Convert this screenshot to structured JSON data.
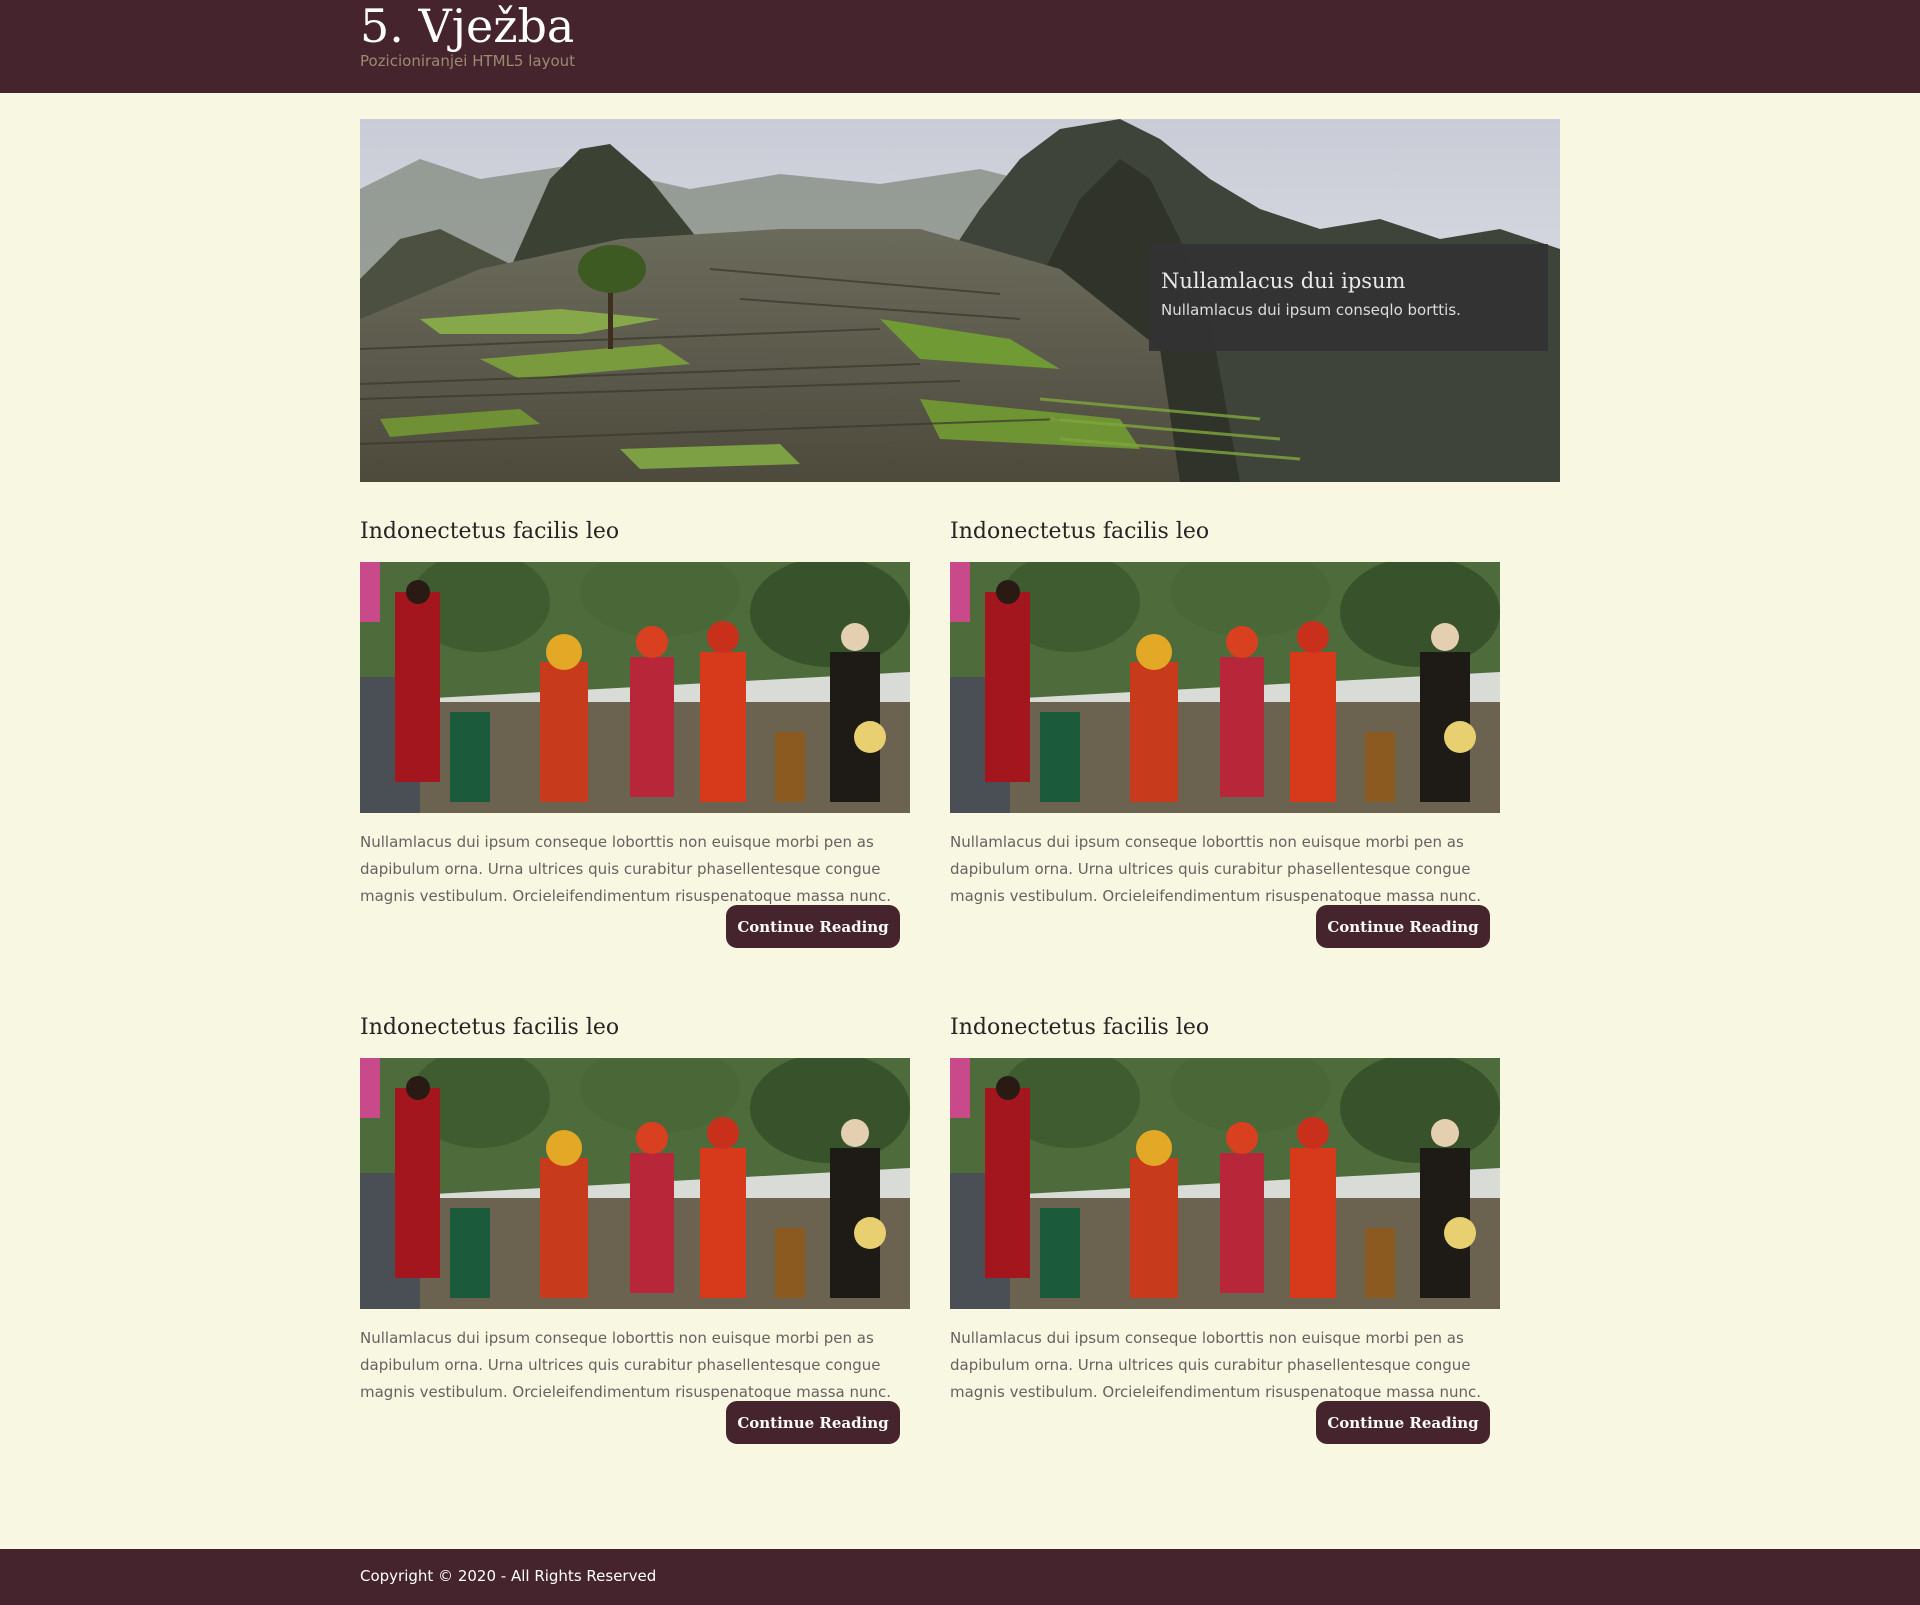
{
  "header": {
    "title": "5. Vježba",
    "subtitle": "Pozicioniranjei HTML5 layout"
  },
  "hero": {
    "image": "mountain-ruins-landscape",
    "caption_title": "Nullamlacus dui ipsum",
    "caption_text": "Nullamlacus dui ipsum conseqlo borttis."
  },
  "articles": [
    {
      "title": "Indonectetus facilis leo",
      "image": "costumed-festival-dancers",
      "text": "Nullamlacus dui ipsum conseque loborttis non euisque morbi pen as dapibulum orna. Urna ultrices quis curabitur phasellentesque congue magnis vestibulum. Orcieleifendimentum risuspenatoque massa nunc.",
      "button_label": "Continue Reading"
    },
    {
      "title": "Indonectetus facilis leo",
      "image": "costumed-festival-dancers",
      "text": "Nullamlacus dui ipsum conseque loborttis non euisque morbi pen as dapibulum orna. Urna ultrices quis curabitur phasellentesque congue magnis vestibulum. Orcieleifendimentum risuspenatoque massa nunc.",
      "button_label": "Continue Reading"
    },
    {
      "title": "Indonectetus facilis leo",
      "image": "costumed-festival-dancers",
      "text": "Nullamlacus dui ipsum conseque loborttis non euisque morbi pen as dapibulum orna. Urna ultrices quis curabitur phasellentesque congue magnis vestibulum. Orcieleifendimentum risuspenatoque massa nunc.",
      "button_label": "Continue Reading"
    },
    {
      "title": "Indonectetus facilis leo",
      "image": "costumed-festival-dancers",
      "text": "Nullamlacus dui ipsum conseque loborttis non euisque morbi pen as dapibulum orna. Urna ultrices quis curabitur phasellentesque congue magnis vestibulum. Orcieleifendimentum risuspenatoque massa nunc.",
      "button_label": "Continue Reading"
    }
  ],
  "footer": {
    "copyright": "Copyright © 2020 - All Rights Reserved"
  },
  "colors": {
    "brand": "#45242e",
    "background": "#f8f8e2",
    "caption_background": "#333333"
  }
}
